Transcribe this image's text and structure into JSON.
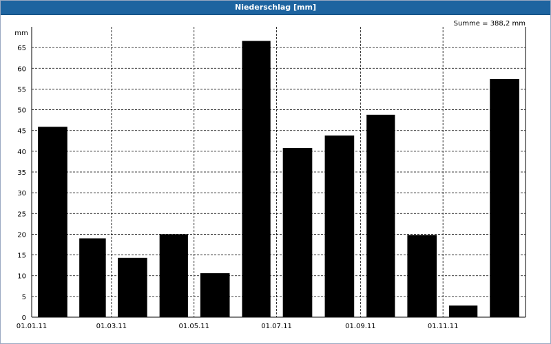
{
  "window": {
    "title": "Niederschlag [mm]"
  },
  "chart_data": {
    "type": "bar",
    "title": "Niederschlag [mm]",
    "ylabel": "mm",
    "summary": "Summe = 388,2 mm",
    "bar_color": "#000000",
    "ylim": [
      0,
      70
    ],
    "yticks": [
      0,
      5,
      10,
      15,
      20,
      25,
      30,
      35,
      40,
      45,
      50,
      55,
      60,
      65
    ],
    "xrange": [
      "2011-01-01",
      "2012-01-01"
    ],
    "xticks": [
      {
        "date": "2011-01-01",
        "label": "01.01.11"
      },
      {
        "date": "2011-03-01",
        "label": "01.03.11"
      },
      {
        "date": "2011-05-01",
        "label": "01.05.11"
      },
      {
        "date": "2011-07-01",
        "label": "01.07.11"
      },
      {
        "date": "2011-09-01",
        "label": "01.09.11"
      },
      {
        "date": "2011-11-01",
        "label": "01.11.11"
      }
    ],
    "grid": true,
    "x": [
      "2011-01",
      "2011-02",
      "2011-03",
      "2011-04",
      "2011-05",
      "2011-06",
      "2011-07",
      "2011-08",
      "2011-09",
      "2011-10",
      "2011-11",
      "2011-12"
    ],
    "values": [
      45.9,
      19.0,
      14.3,
      20.0,
      10.6,
      66.6,
      40.8,
      43.8,
      48.8,
      19.8,
      2.8,
      57.4
    ]
  }
}
